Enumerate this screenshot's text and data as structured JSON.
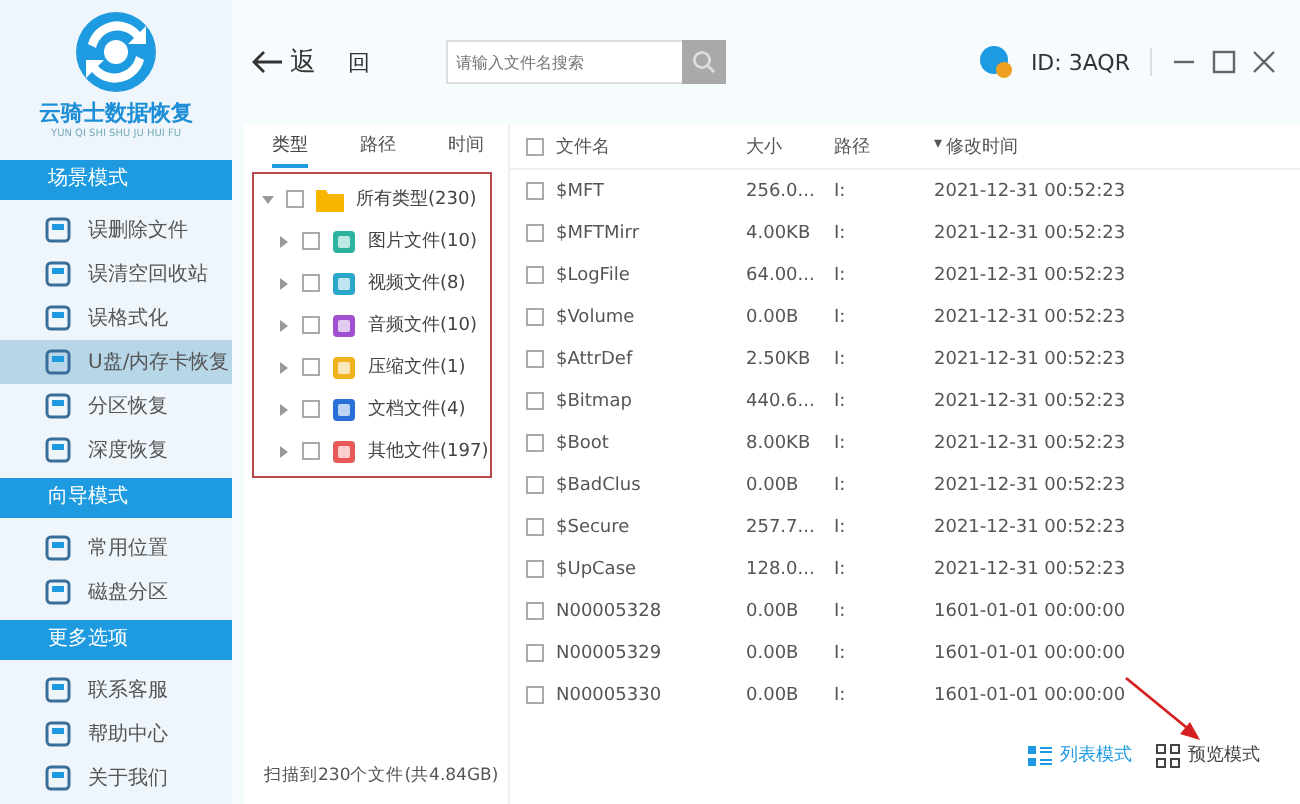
{
  "app": {
    "title": "云骑士数据恢复",
    "subtitle": "YUN QI SHI SHU JU HUI FU"
  },
  "sidebar": {
    "sections": [
      {
        "title": "场景模式",
        "items": [
          {
            "label": "误删除文件",
            "selected": false
          },
          {
            "label": "误清空回收站",
            "selected": false
          },
          {
            "label": "误格式化",
            "selected": false
          },
          {
            "label": "U盘/内存卡恢复",
            "selected": true
          },
          {
            "label": "分区恢复",
            "selected": false
          },
          {
            "label": "深度恢复",
            "selected": false
          }
        ]
      },
      {
        "title": "向导模式",
        "items": [
          {
            "label": "常用位置",
            "selected": false
          },
          {
            "label": "磁盘分区",
            "selected": false
          }
        ]
      },
      {
        "title": "更多选项",
        "items": [
          {
            "label": "联系客服",
            "selected": false
          },
          {
            "label": "帮助中心",
            "selected": false
          },
          {
            "label": "关于我们",
            "selected": false
          }
        ]
      }
    ]
  },
  "toolbar": {
    "back": "返",
    "up": "回",
    "search": {
      "placeholder": "请输入文件名搜索"
    }
  },
  "account": {
    "id": "ID: 3AQR"
  },
  "filter_tabs": [
    {
      "label": "类型",
      "selected": true
    },
    {
      "label": "路径",
      "selected": false
    },
    {
      "label": "时间",
      "selected": false
    }
  ],
  "type_tree": {
    "label": "所有类型(230)",
    "expanded": true,
    "checked": false,
    "children": [
      {
        "label": "图片文件(10)",
        "kind": "image",
        "expanded": false,
        "checked": false
      },
      {
        "label": "视频文件(8)",
        "kind": "video",
        "expanded": false,
        "checked": false
      },
      {
        "label": "音频文件(10)",
        "kind": "audio",
        "expanded": false,
        "checked": false
      },
      {
        "label": "压缩文件(1)",
        "kind": "archive",
        "expanded": false,
        "checked": false
      },
      {
        "label": "文档文件(4)",
        "kind": "document",
        "expanded": false,
        "checked": false
      },
      {
        "label": "其他文件(197)",
        "kind": "other",
        "expanded": false,
        "checked": false
      }
    ]
  },
  "table": {
    "columns": [
      "文件名",
      "大小",
      "路径",
      "修改时间"
    ],
    "sort_mark": "▾",
    "all_checked": false,
    "rows": [
      {
        "checked": false,
        "cells": [
          "$MFT",
          "256.0...",
          "I:",
          "2021-12-31 00:52:23"
        ]
      },
      {
        "checked": false,
        "cells": [
          "$MFTMirr",
          "4.00KB",
          "I:",
          "2021-12-31 00:52:23"
        ]
      },
      {
        "checked": false,
        "cells": [
          "$LogFile",
          "64.00...",
          "I:",
          "2021-12-31 00:52:23"
        ]
      },
      {
        "checked": false,
        "cells": [
          "$Volume",
          "0.00B",
          "I:",
          "2021-12-31 00:52:23"
        ]
      },
      {
        "checked": false,
        "cells": [
          "$AttrDef",
          "2.50KB",
          "I:",
          "2021-12-31 00:52:23"
        ]
      },
      {
        "checked": false,
        "cells": [
          "$Bitmap",
          "440.6...",
          "I:",
          "2021-12-31 00:52:23"
        ]
      },
      {
        "checked": false,
        "cells": [
          "$Boot",
          "8.00KB",
          "I:",
          "2021-12-31 00:52:23"
        ]
      },
      {
        "checked": false,
        "cells": [
          "$BadClus",
          "0.00B",
          "I:",
          "2021-12-31 00:52:23"
        ]
      },
      {
        "checked": false,
        "cells": [
          "$Secure",
          "257.7...",
          "I:",
          "2021-12-31 00:52:23"
        ]
      },
      {
        "checked": false,
        "cells": [
          "$UpCase",
          "128.0...",
          "I:",
          "2021-12-31 00:52:23"
        ]
      },
      {
        "checked": false,
        "cells": [
          "N00005328",
          "0.00B",
          "I:",
          "1601-01-01 00:00:00"
        ]
      },
      {
        "checked": false,
        "cells": [
          "N00005329",
          "0.00B",
          "I:",
          "1601-01-01 00:00:00"
        ]
      },
      {
        "checked": false,
        "cells": [
          "N00005330",
          "0.00B",
          "I:",
          "1601-01-01 00:00:00"
        ]
      }
    ]
  },
  "status": "扫描到230个文件(共4.84GB)",
  "view_modes": [
    {
      "label": "列表模式",
      "kind": "list",
      "selected": true
    },
    {
      "label": "预览模式",
      "kind": "grid",
      "selected": false
    }
  ]
}
